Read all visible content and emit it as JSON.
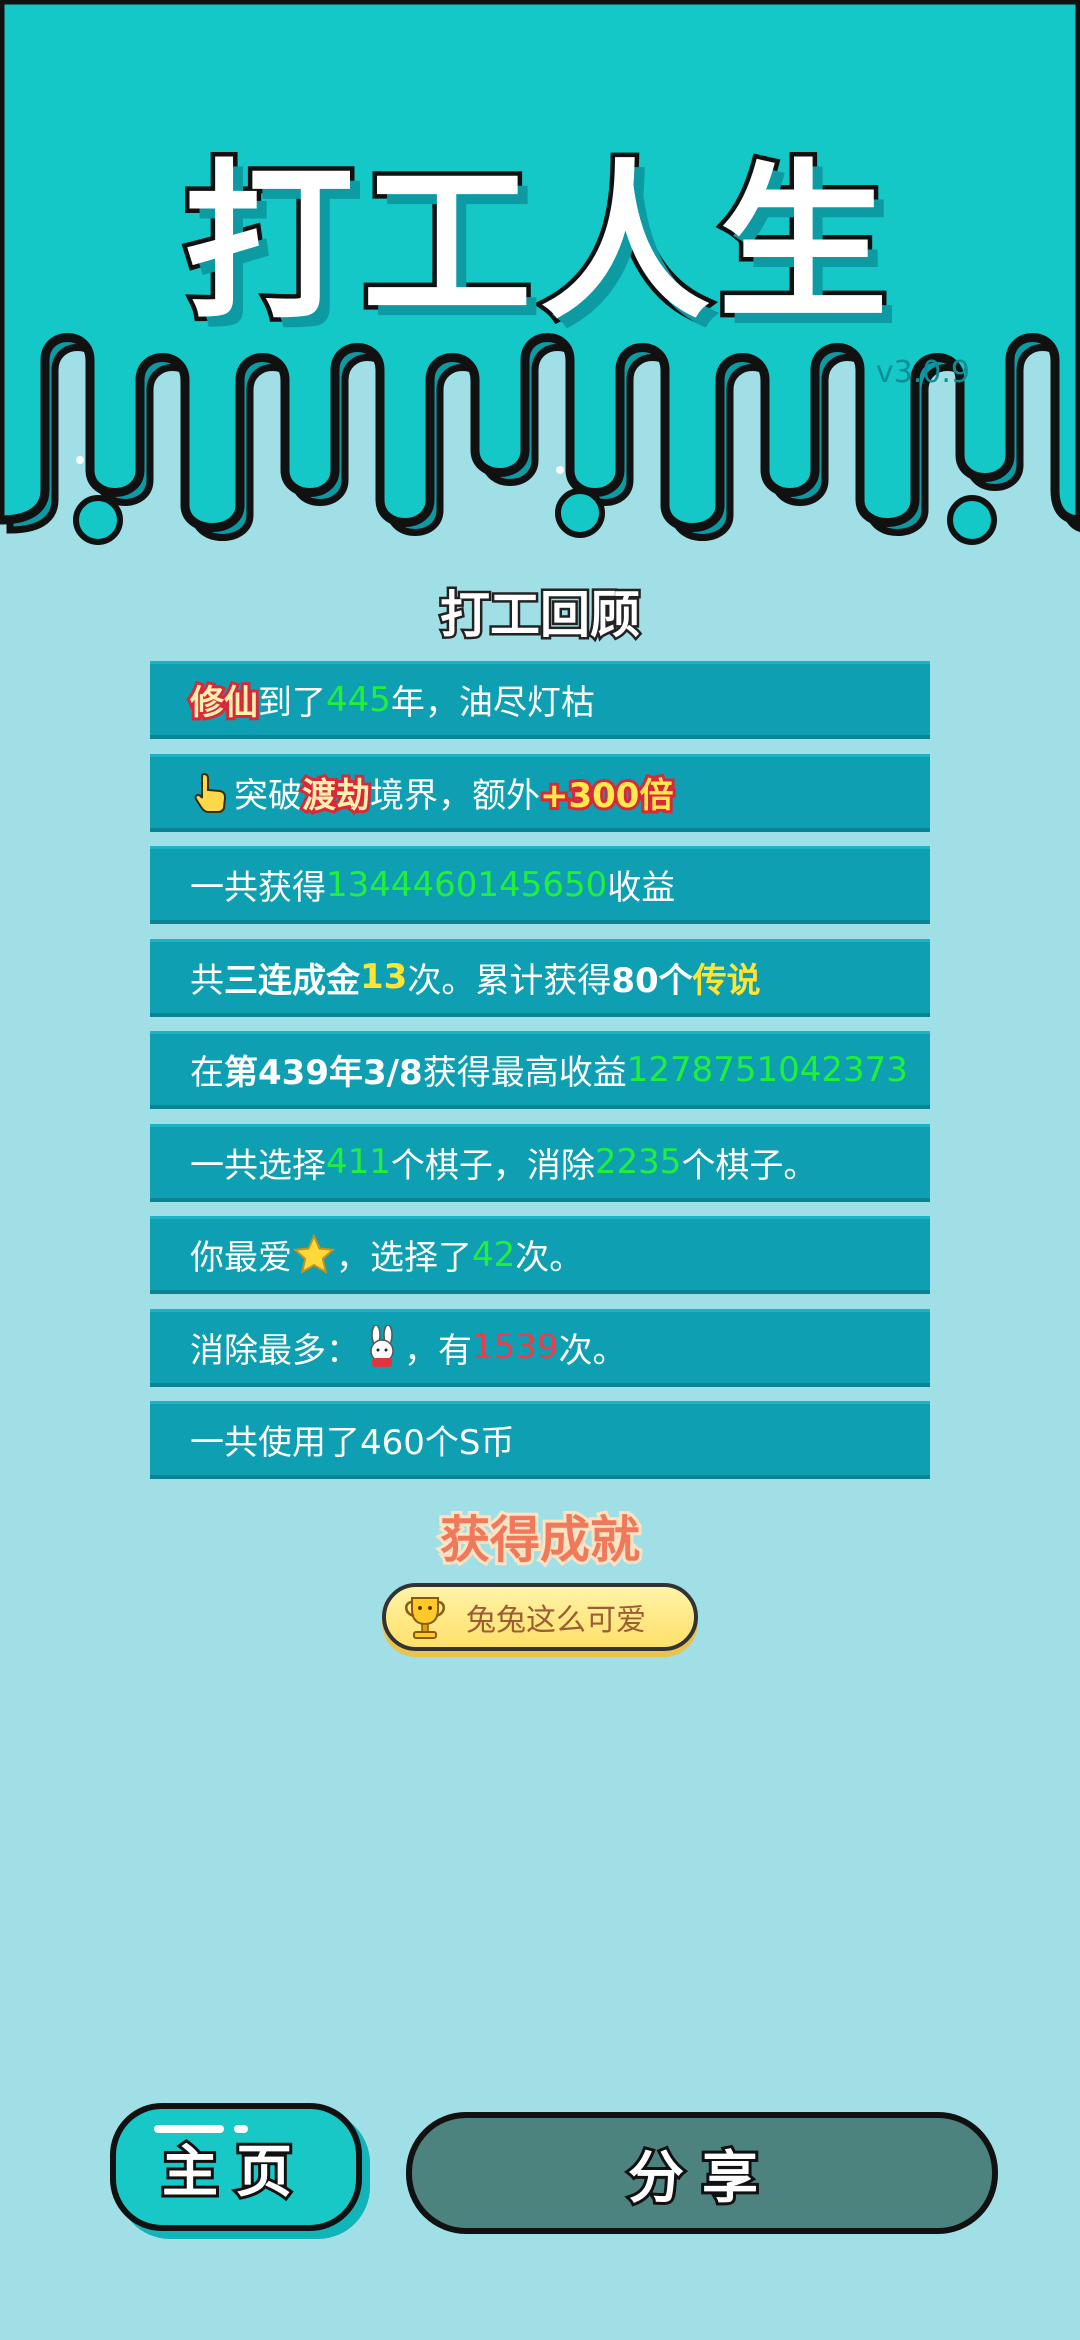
{
  "header": {
    "title": "打工人生",
    "version": "v3.0.9"
  },
  "review": {
    "title": "打工回顾",
    "rows": [
      [
        "修仙",
        "到了",
        "445",
        "年，油尽灯枯"
      ],
      [
        "突破",
        "渡劫",
        "境界，额外",
        "+300倍"
      ],
      [
        "一共获得",
        "1344460145650",
        "收益"
      ],
      [
        "共",
        "三连成金",
        "13",
        "次。累计获得",
        "80个",
        "传说"
      ],
      [
        "在 ",
        "第439年3/8",
        " 获得最高收益",
        "1278751042373"
      ],
      [
        "一共选择",
        "411",
        "个棋子，消除",
        "2235",
        "个棋子。"
      ],
      [
        "你最爱",
        "，选择了",
        "42",
        "次。"
      ],
      [
        "消除最多：",
        "，有",
        "1539",
        "次。"
      ],
      [
        "一共使用了460个S币"
      ]
    ]
  },
  "icons": {
    "pointer": "hand-pointer-icon",
    "favorite": "star-icon",
    "most_removed": "rabbit-icon",
    "achievement": "trophy-icon"
  },
  "achievement": {
    "title": "获得成就",
    "badge_label": "兔兔这么可爱"
  },
  "buttons": {
    "home": "主页",
    "share": "分享"
  },
  "colors": {
    "header_bg": "#15c8c8",
    "page_bg": "#a1dfe6",
    "row_bg": "#0ea0b2",
    "number_green": "#22ef3a",
    "number_yellow": "#ffe533",
    "number_red": "#ef3b4a",
    "home_button": "#17c8c6",
    "share_button": "#4c837e"
  }
}
